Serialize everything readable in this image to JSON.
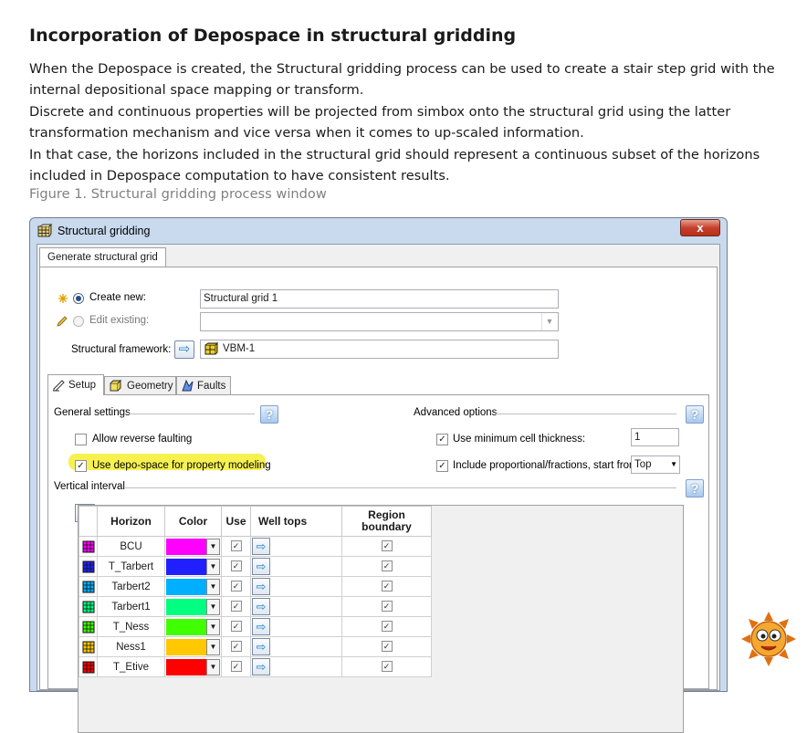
{
  "doc": {
    "heading": "Incorporation of Depospace in structural gridding",
    "para1": "When the Depospace is created, the Structural gridding process can be used to create a stair step grid with the internal depositional space mapping or transform.",
    "para2": "Discrete and continuous properties will be projected from simbox onto the structural grid using the latter transformation mechanism and vice versa when it comes to up-scaled information.",
    "para3": "In that case, the horizons included in the structural grid should represent a continuous subset of the horizons included in Depospace computation to have consistent results.",
    "caption": "Figure 1. Structural gridding process window"
  },
  "window": {
    "title": "Structural gridding",
    "close_glyph": "x",
    "main_tab": "Generate structural grid",
    "create_new_label": "Create new:",
    "create_new_value": "Structural grid 1",
    "edit_existing_label": "Edit existing:",
    "edit_existing_value": "",
    "framework_label": "Structural framework:",
    "framework_value": "VBM-1",
    "tabs": [
      "Setup",
      "Geometry",
      "Faults"
    ],
    "general_settings": "General settings",
    "advanced_options": "Advanced options",
    "allow_reverse": "Allow reverse faulting",
    "use_depospace": "Use depo-space for property modeling",
    "use_min_cell": "Use minimum cell thickness:",
    "min_cell_value": "1",
    "include_prop": "Include proportional/fractions, start from:",
    "include_prop_value": "Top",
    "vertical_interval": "Vertical interval",
    "help_glyph": "?"
  },
  "table": {
    "headers": [
      "Horizon",
      "Color",
      "Use",
      "Well tops",
      "Region boundary"
    ],
    "rows": [
      {
        "horizon": "BCU",
        "color": "#ff00ff"
      },
      {
        "horizon": "T_Tarbert",
        "color": "#2020ff"
      },
      {
        "horizon": "Tarbert2",
        "color": "#00b0ff"
      },
      {
        "horizon": "Tarbert1",
        "color": "#00ff80"
      },
      {
        "horizon": "T_Ness",
        "color": "#40ff00"
      },
      {
        "horizon": "Ness1",
        "color": "#ffc800"
      },
      {
        "horizon": "T_Etive",
        "color": "#ff0000"
      }
    ]
  }
}
